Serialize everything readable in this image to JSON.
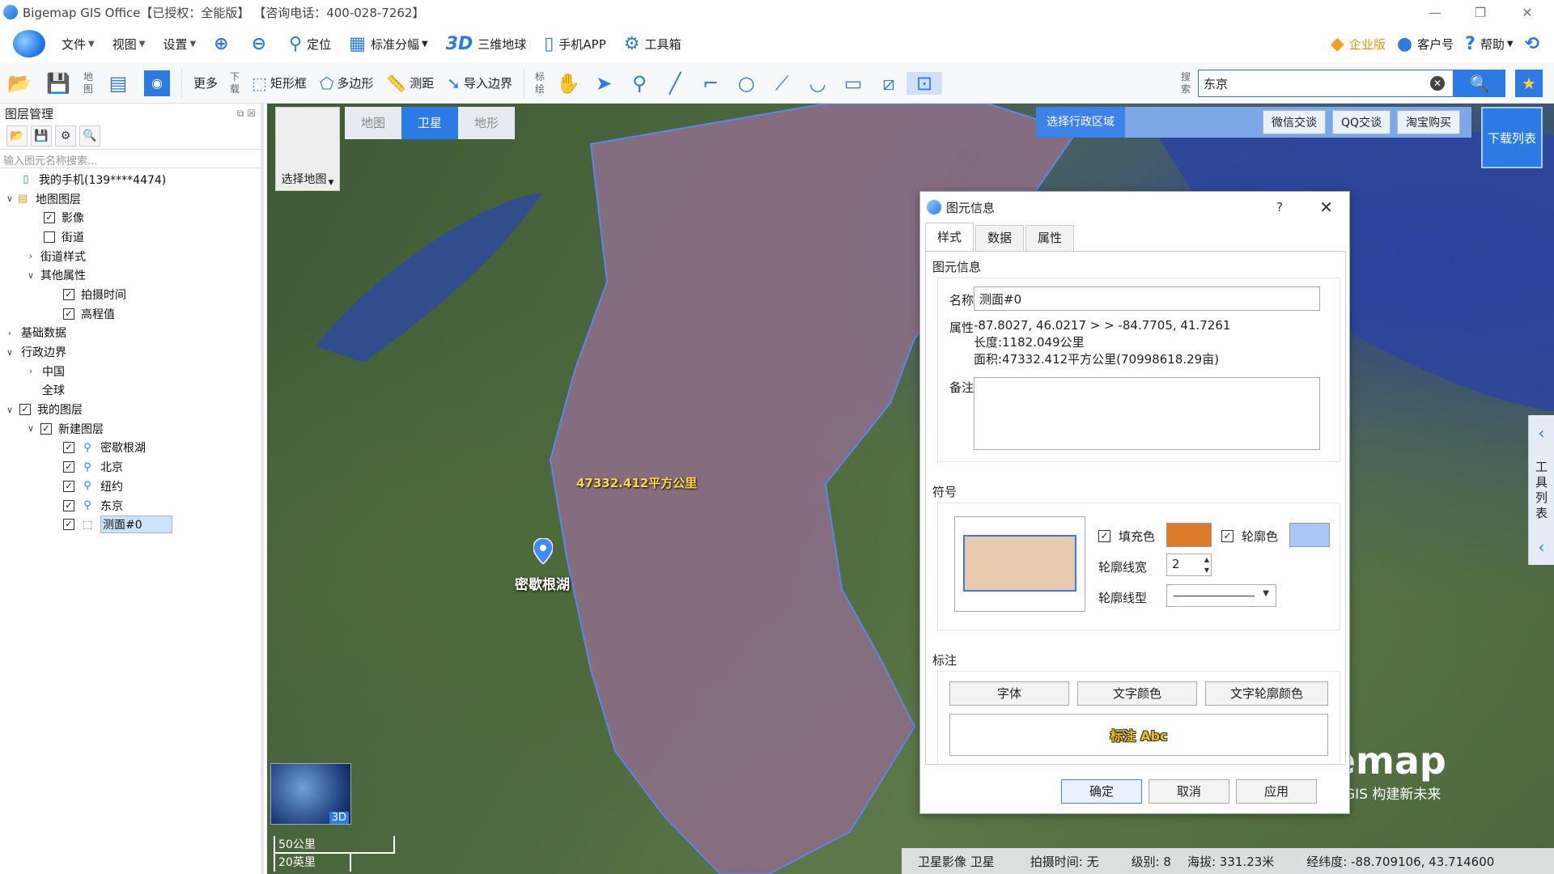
{
  "titlebar": {
    "title": "Bigemap GIS Office【已授权：全能版】 【咨询电话：400-028-7262】",
    "minimize": "—",
    "restore": "❐",
    "close": "✕"
  },
  "menu": {
    "file": "文件",
    "view": "视图",
    "settings": "设置",
    "locate": "定位",
    "sheet": "标准分幅",
    "three_d_icon": "3D",
    "globe": "三维地球",
    "mobile": "手机APP",
    "toolbox": "工具箱",
    "enterprise": "企业版",
    "account": "客户号",
    "help": "帮助"
  },
  "toolbar": {
    "map_label": "地图",
    "more": "更多",
    "download_label": "下载",
    "rect": "矩形框",
    "polygon": "多边形",
    "measure": "测距",
    "import": "导入边界",
    "mark_label": "标绘",
    "search_label": "搜索",
    "search_value": "东京"
  },
  "layers": {
    "title": "图层管理",
    "search_placeholder": "输入图元名称搜索...",
    "items": [
      {
        "label": "我的手机(139****4474)",
        "level": 1
      },
      {
        "label": "地图图层",
        "level": 0
      },
      {
        "label": "影像",
        "level": 2
      },
      {
        "label": "街道",
        "level": 2
      },
      {
        "label": "街道样式",
        "level": 1
      },
      {
        "label": "其他属性",
        "level": 1
      },
      {
        "label": "拍摄时间",
        "level": 3
      },
      {
        "label": "高程值",
        "level": 3
      },
      {
        "label": "基础数据",
        "level": 0
      },
      {
        "label": "行政边界",
        "level": 0
      },
      {
        "label": "中国",
        "level": 1
      },
      {
        "label": "全球",
        "level": 1
      },
      {
        "label": "我的图层",
        "level": 0
      },
      {
        "label": "新建图层",
        "level": 1
      },
      {
        "label": "密歇根湖",
        "level": 2
      },
      {
        "label": "北京",
        "level": 2
      },
      {
        "label": "纽约",
        "level": 2
      },
      {
        "label": "东京",
        "level": 2
      },
      {
        "label": "测面#0",
        "level": 2
      }
    ]
  },
  "map": {
    "choose_map": "选择地图",
    "tabs": [
      "地图",
      "卫星",
      "地形"
    ],
    "active_tab": "卫星",
    "region_button": "选择行政区域",
    "wechat": "微信交谈",
    "qq": "QQ交谈",
    "taobao": "淘宝购买",
    "download": "下载列表",
    "globe_3d": "3D",
    "area_label": "47332.412平方公里",
    "marker_label": "密歇根湖",
    "scale_km": "50公里",
    "scale_mi": "20英里",
    "side_tab": "工具列表",
    "watermark_brand": "Bigemap",
    "watermark_slogan": "应用新GIS 构建新未来",
    "polygon_fill": "#8a6e84",
    "polygon_stroke": "#5b86f0"
  },
  "status": {
    "imagery": "卫星影像 卫星",
    "capture_time": "拍摄时间: 无",
    "level": "级别:  8",
    "elevation": "海拔: 331.23米",
    "coords": "经纬度:  -88.709106, 43.714600"
  },
  "dialog": {
    "title": "图元信息",
    "help": "?",
    "close": "✕",
    "tabs": [
      "样式",
      "数据",
      "属性"
    ],
    "active_tab": "样式",
    "section_info": "图元信息",
    "name_label": "名称",
    "name_value": "测面#0",
    "attr_label": "属性",
    "attr_line1": "-87.8027, 46.0217 > > -84.7705, 41.7261",
    "attr_line2": "长度:1182.049公里",
    "attr_line3": "面积:47332.412平方公里(70998618.29亩)",
    "note_label": "备注",
    "note_value": "",
    "section_symbol": "符号",
    "fill_label": "填充色",
    "fill_color": "#dd7a2a",
    "outline_label": "轮廓色",
    "outline_color": "#a9c6f5",
    "outline_width_label": "轮廓线宽",
    "outline_width": "2",
    "outline_type_label": "轮廓线型",
    "section_label": "标注",
    "font_btn": "字体",
    "text_color_btn": "文字颜色",
    "text_outline_btn": "文字轮廓颜色",
    "label_preview": "标注 Abc",
    "ok": "确定",
    "cancel": "取消",
    "apply": "应用"
  }
}
